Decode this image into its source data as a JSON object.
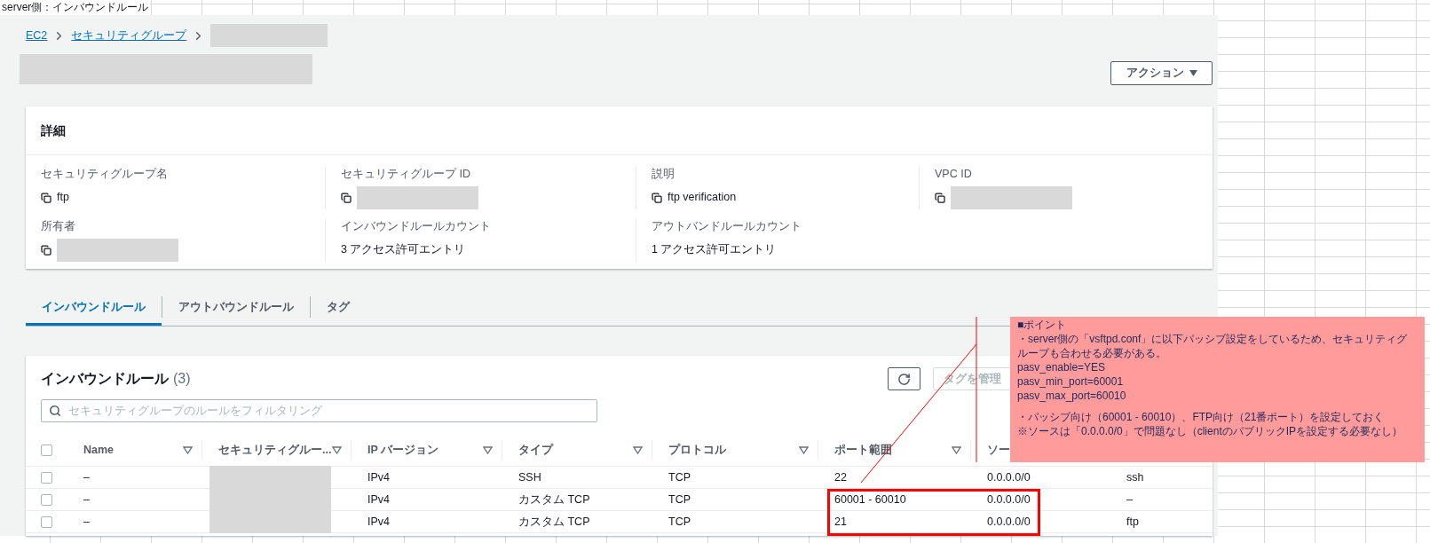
{
  "sheet_title": "server側：インバウンドルール",
  "breadcrumb": [
    {
      "label": "EC2"
    },
    {
      "label": "セキュリティグループ"
    }
  ],
  "breadcrumb_current_redacted": true,
  "title_redacted": true,
  "actions_button": "アクション",
  "details": {
    "title": "詳細",
    "fields": [
      {
        "label": "セキュリティグループ名",
        "value": "ftp",
        "redacted": false,
        "copyable": true
      },
      {
        "label": "セキュリティグループ ID",
        "redacted": true,
        "copyable": true
      },
      {
        "label": "説明",
        "value": "ftp verification",
        "redacted": false,
        "copyable": true
      },
      {
        "label": "VPC ID",
        "redacted": true,
        "copyable": true
      },
      {
        "label": "所有者",
        "redacted": true,
        "copyable": true
      },
      {
        "label": "インバウンドルールカウント",
        "value": "3 アクセス許可エントリ",
        "redacted": false,
        "copyable": false
      },
      {
        "label": "アウトバンドルールカウント",
        "value": "1 アクセス許可エントリ",
        "redacted": false,
        "copyable": false
      }
    ]
  },
  "tabs": [
    {
      "label": "インバウンドルール",
      "selected": true
    },
    {
      "label": "アウトバウンドルール",
      "selected": false
    },
    {
      "label": "タグ",
      "selected": false
    }
  ],
  "rules": {
    "title": "インバウンドルール",
    "count": "(3)",
    "manage_tags_button": "タグを管理",
    "search": {
      "placeholder": "セキュリティグループのルールをフィルタリング"
    },
    "header_checked": false,
    "columns": [
      {
        "label": "Name",
        "sortable": true
      },
      {
        "label": "セキュリティグルー...",
        "sortable": true
      },
      {
        "label": "IP バージョン",
        "sortable": true
      },
      {
        "label": "タイプ",
        "sortable": true
      },
      {
        "label": "プロトコル",
        "sortable": true
      },
      {
        "label": "ポート範囲",
        "sortable": true
      },
      {
        "label": "ソー",
        "sortable": false
      }
    ],
    "rows": [
      {
        "checked": false,
        "name": "–",
        "redacted": true,
        "ip_version": "IPv4",
        "type": "SSH",
        "protocol": "TCP",
        "port_range": "22",
        "source": "0.0.0.0/0",
        "column_8": "ssh",
        "highlighted": false
      },
      {
        "checked": false,
        "name": "–",
        "redacted": true,
        "ip_version": "IPv4",
        "type": "カスタム TCP",
        "protocol": "TCP",
        "port_range": "60001 - 60010",
        "source": "0.0.0.0/0",
        "column_8": "–",
        "highlighted": true
      },
      {
        "checked": false,
        "name": "–",
        "redacted": true,
        "ip_version": "IPv4",
        "type": "カスタム TCP",
        "protocol": "TCP",
        "port_range": "21",
        "source": "0.0.0.0/0",
        "column_8": "ftp",
        "highlighted": true
      }
    ]
  },
  "note": {
    "lines": [
      "■ポイント",
      "・server側の「vsftpd.conf」に以下パッシブ設定をしているため、セキュリティグループも合わせる必要がある。",
      "pasv_enable=YES",
      "pasv_min_port=60001",
      "pasv_max_port=60010"
    ],
    "remarks": [
      "・パッシブ向け（60001 - 60010）、FTP向け（21番ポート）を設定しておく",
      "※ソースは「0.0.0.0/0」で問題なし（clientのパブリックIPを設定する必要なし）"
    ]
  }
}
